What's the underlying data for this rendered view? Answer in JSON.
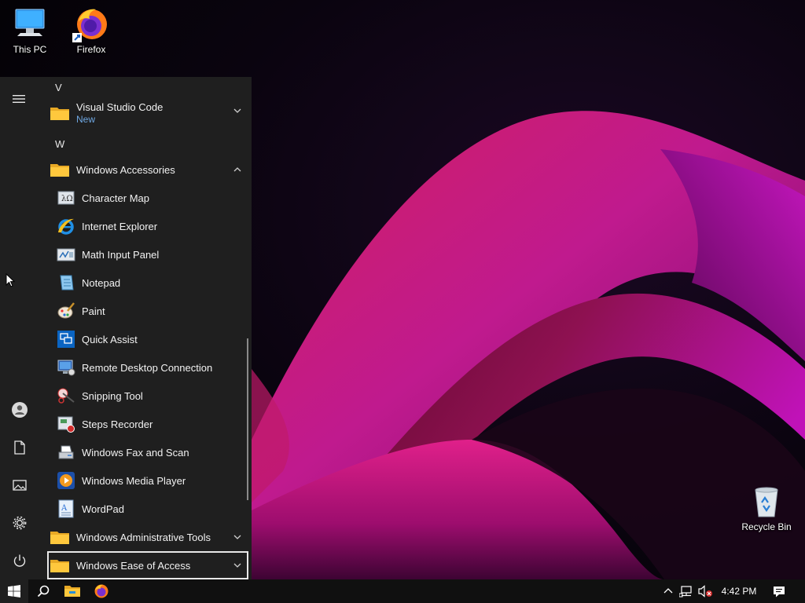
{
  "desktop": {
    "icons": [
      {
        "label": "This PC",
        "icon": "computer-icon"
      },
      {
        "label": "Firefox",
        "icon": "firefox-icon"
      },
      {
        "label": "Recycle Bin",
        "icon": "recycle-bin-icon"
      }
    ]
  },
  "start_menu": {
    "rail": [
      "hamburger-menu-icon",
      "user-account-icon",
      "documents-icon",
      "pictures-icon",
      "settings-icon",
      "power-icon"
    ],
    "letters": [
      "V",
      "W"
    ],
    "items": [
      {
        "label": "Visual Studio Code",
        "badge": "New",
        "type": "folder",
        "expanded": false
      },
      {
        "label": "Windows Accessories",
        "type": "folder",
        "expanded": true
      },
      {
        "label": "Character Map",
        "icon": "character-map-icon"
      },
      {
        "label": "Internet Explorer",
        "icon": "internet-explorer-icon"
      },
      {
        "label": "Math Input Panel",
        "icon": "math-input-panel-icon"
      },
      {
        "label": "Notepad",
        "icon": "notepad-icon"
      },
      {
        "label": "Paint",
        "icon": "paint-icon"
      },
      {
        "label": "Quick Assist",
        "icon": "quick-assist-icon"
      },
      {
        "label": "Remote Desktop Connection",
        "icon": "remote-desktop-icon"
      },
      {
        "label": "Snipping Tool",
        "icon": "snipping-tool-icon"
      },
      {
        "label": "Steps Recorder",
        "icon": "steps-recorder-icon"
      },
      {
        "label": "Windows Fax and Scan",
        "icon": "fax-scan-icon"
      },
      {
        "label": "Windows Media Player",
        "icon": "media-player-icon"
      },
      {
        "label": "WordPad",
        "icon": "wordpad-icon"
      },
      {
        "label": "Windows Administrative Tools",
        "type": "folder",
        "expanded": false
      },
      {
        "label": "Windows Ease of Access",
        "type": "folder",
        "expanded": false,
        "selected": true
      }
    ]
  },
  "taskbar": {
    "pinned": [
      "windows-start-icon",
      "search-icon",
      "file-explorer-icon",
      "firefox-icon"
    ],
    "tray": [
      "show-hidden-icons-chevron",
      "network-icon",
      "volume-muted-icon"
    ],
    "clock": "4:42 PM",
    "notification_icon": "action-center-icon"
  },
  "colors": {
    "menu_bg": "#1f1f1f",
    "taskbar_bg": "#101010",
    "accent_link": "#6fa8e3",
    "wallpaper_magenta": "#b0169a"
  }
}
